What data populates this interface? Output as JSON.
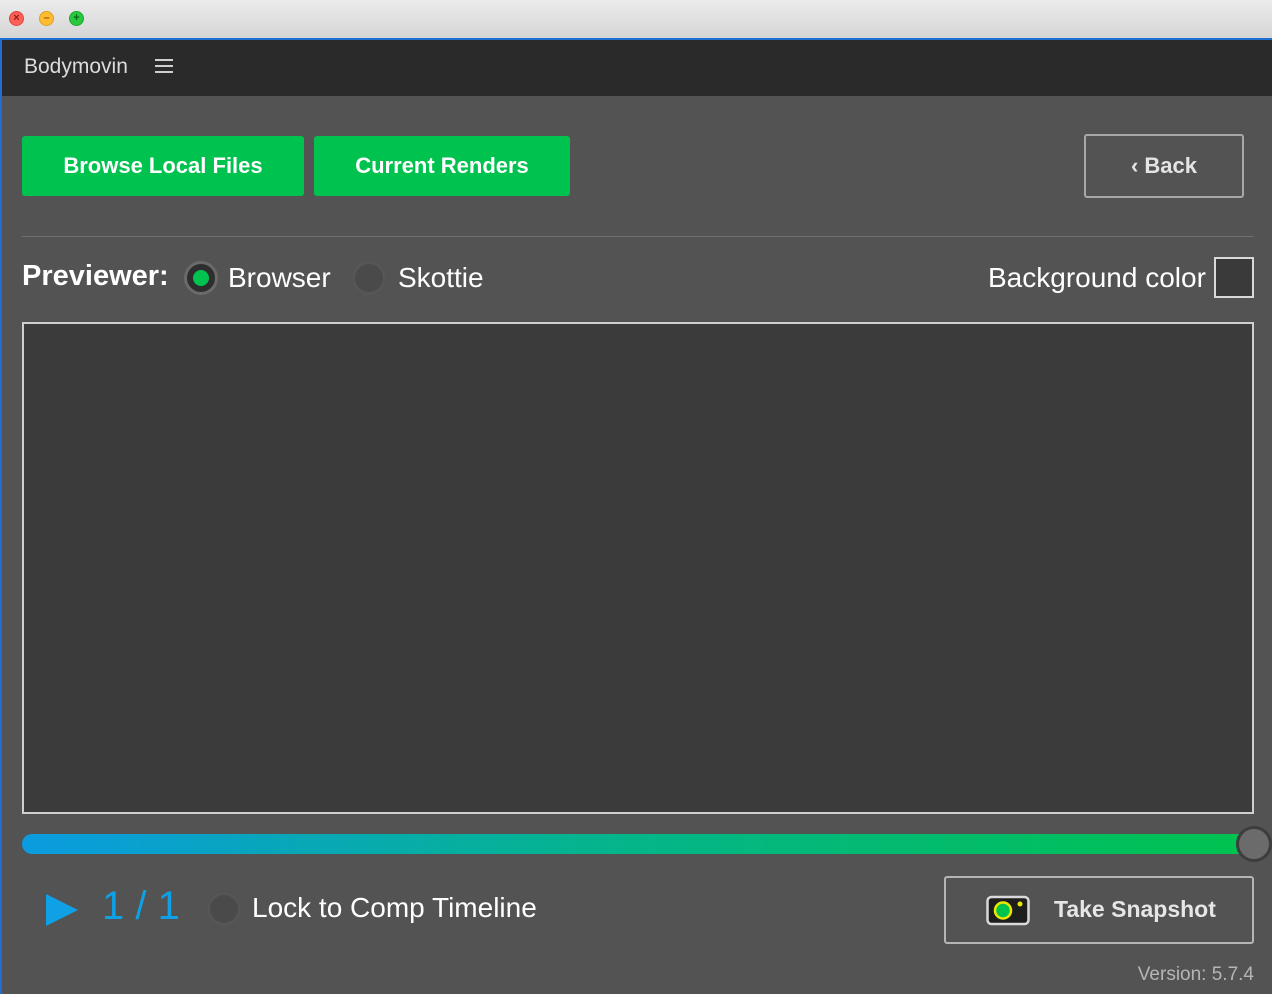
{
  "app": {
    "title": "Bodymovin",
    "menu_icon": "hamburger-menu-icon"
  },
  "toolbar": {
    "browse_label": "Browse Local Files",
    "renders_label": "Current Renders",
    "back_label": "‹ Back"
  },
  "previewer": {
    "label": "Previewer:",
    "options": [
      {
        "label": "Browser",
        "selected": true
      },
      {
        "label": "Skottie",
        "selected": false
      }
    ],
    "background_label": "Background color",
    "background_swatch": "#3a3a3a"
  },
  "timeline": {
    "progress": 1.0,
    "frame_display": "1 / 1",
    "lock_label": "Lock to Comp Timeline",
    "lock_checked": false
  },
  "snapshot": {
    "label": "Take Snapshot",
    "icon": "camera-icon"
  },
  "footer": {
    "version": "Version: 5.7.4"
  },
  "colors": {
    "accent_green": "#00c24f",
    "accent_blue": "#0fa0e6",
    "panel_bg": "#535353"
  }
}
